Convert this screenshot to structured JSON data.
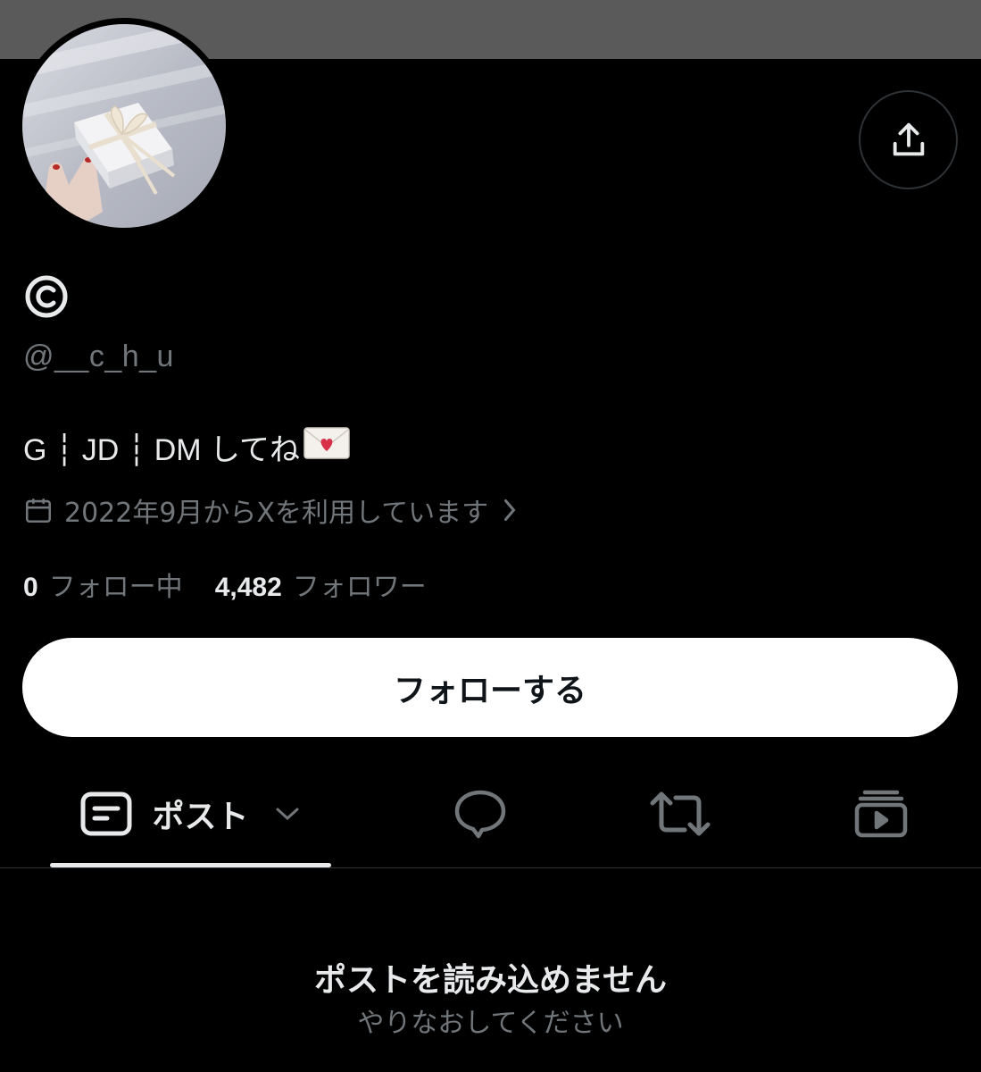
{
  "profile": {
    "display_name_icon": "copyright-icon",
    "display_name": "©",
    "handle": "@__c_h_u",
    "bio_text": "G ┆ JD ┆ DM してね",
    "bio_emoji": "love-letter-icon",
    "joined": "2022年9月からXを利用しています",
    "following_count": "0",
    "following_label": "フォロー中",
    "followers_count": "4,482",
    "followers_label": "フォロワー"
  },
  "actions": {
    "follow_label": "フォローする",
    "share_icon": "share-icon"
  },
  "tabs": {
    "posts_label": "ポスト",
    "posts_icon": "posts-icon",
    "replies_icon": "reply-icon",
    "reposts_icon": "repost-icon",
    "media_icon": "media-icon"
  },
  "feed": {
    "error_title": "ポストを読み込めません",
    "error_subtitle": "やりなおしてください"
  },
  "colors": {
    "background": "#000000",
    "banner": "#5a5a5a",
    "primary_text": "#e7e9ea",
    "secondary_text": "#71767b",
    "divider": "#2f3336",
    "button_bg": "#ffffff"
  }
}
